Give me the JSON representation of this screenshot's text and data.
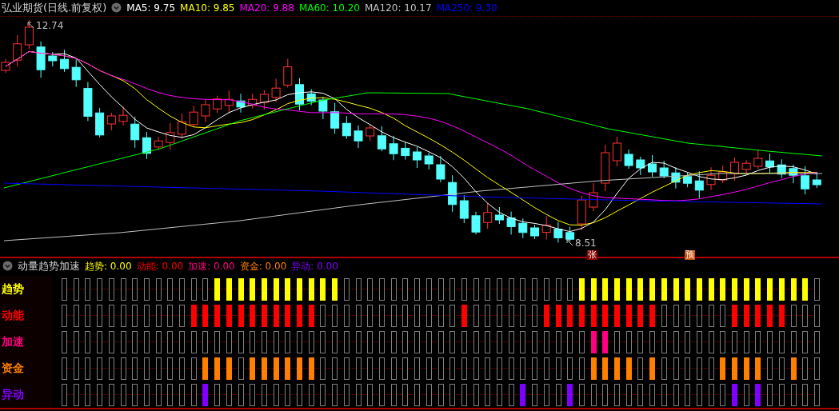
{
  "chart": {
    "title": "弘业期货(日线.前复权)",
    "ma_legend": [
      {
        "label": "MA5: 9.75",
        "color": "#ffffff"
      },
      {
        "label": "MA10: 9.85",
        "color": "#ffff00"
      },
      {
        "label": "MA20: 9.88",
        "color": "#ff00ff"
      },
      {
        "label": "MA60: 10.20",
        "color": "#00ff00"
      },
      {
        "label": "MA120: 10.17",
        "color": "#c0c0c0"
      },
      {
        "label": "MA250: 9.30",
        "color": "#0000ff"
      }
    ],
    "high_marker": "12.74",
    "low_marker": "8.51",
    "badges": [
      {
        "text": "张",
        "kind": "rise"
      },
      {
        "text": "预",
        "kind": "warn"
      }
    ]
  },
  "indicator": {
    "title": "动量趋势加速",
    "legend": [
      {
        "label": "趋势: 0.00",
        "color": "#ffff00"
      },
      {
        "label": "动能: 0.00",
        "color": "#ff0000"
      },
      {
        "label": "加速: 0.00",
        "color": "#ff0080"
      },
      {
        "label": "资金: 0.00",
        "color": "#ff8000"
      },
      {
        "label": "异动: 0.00",
        "color": "#8000ff"
      }
    ],
    "rows": [
      {
        "label": "趋势",
        "color": "#ffff00",
        "filled": [
          false,
          false,
          false,
          false,
          false,
          false,
          false,
          false,
          false,
          false,
          false,
          false,
          false,
          true,
          true,
          true,
          true,
          true,
          true,
          true,
          true,
          true,
          true,
          true,
          false,
          false,
          false,
          false,
          false,
          false,
          false,
          false,
          false,
          false,
          false,
          false,
          false,
          false,
          false,
          false,
          false,
          false,
          false,
          false,
          true,
          true,
          true,
          true,
          true,
          true,
          true,
          true,
          true,
          true,
          true,
          true,
          true,
          true,
          true,
          true,
          true,
          true,
          true,
          true,
          false
        ]
      },
      {
        "label": "动能",
        "color": "#ff0000",
        "filled": [
          false,
          false,
          false,
          false,
          false,
          false,
          false,
          false,
          false,
          false,
          false,
          true,
          true,
          true,
          true,
          true,
          true,
          true,
          true,
          true,
          true,
          true,
          false,
          false,
          false,
          false,
          false,
          false,
          false,
          false,
          false,
          false,
          false,
          false,
          true,
          false,
          false,
          false,
          false,
          false,
          false,
          true,
          true,
          true,
          true,
          true,
          true,
          true,
          true,
          true,
          true,
          false,
          false,
          false,
          false,
          false,
          false,
          true,
          true,
          true,
          true,
          true,
          false,
          false,
          false
        ]
      },
      {
        "label": "加速",
        "color": "#ff0080",
        "filled": [
          false,
          false,
          false,
          false,
          false,
          false,
          false,
          false,
          false,
          false,
          false,
          false,
          false,
          false,
          false,
          false,
          false,
          false,
          false,
          false,
          false,
          false,
          false,
          false,
          false,
          false,
          false,
          false,
          false,
          false,
          false,
          false,
          false,
          false,
          false,
          false,
          false,
          false,
          false,
          false,
          false,
          false,
          false,
          false,
          false,
          true,
          true,
          false,
          false,
          false,
          false,
          false,
          false,
          false,
          false,
          false,
          false,
          false,
          false,
          false,
          false,
          false,
          false,
          false,
          false
        ]
      },
      {
        "label": "资金",
        "color": "#ff8000",
        "filled": [
          false,
          false,
          false,
          false,
          false,
          false,
          false,
          false,
          false,
          false,
          false,
          false,
          true,
          true,
          true,
          false,
          true,
          true,
          true,
          true,
          true,
          true,
          false,
          false,
          false,
          false,
          false,
          false,
          false,
          false,
          false,
          false,
          false,
          false,
          false,
          false,
          false,
          false,
          false,
          false,
          false,
          false,
          false,
          false,
          false,
          true,
          true,
          true,
          true,
          false,
          true,
          false,
          false,
          false,
          false,
          false,
          true,
          true,
          true,
          true,
          false,
          false,
          true,
          false,
          false
        ]
      },
      {
        "label": "异动",
        "color": "#8000ff",
        "filled": [
          false,
          false,
          false,
          false,
          false,
          false,
          false,
          false,
          false,
          false,
          false,
          false,
          true,
          false,
          false,
          false,
          false,
          false,
          false,
          false,
          false,
          false,
          false,
          false,
          false,
          false,
          false,
          false,
          false,
          false,
          false,
          false,
          false,
          false,
          false,
          false,
          false,
          false,
          false,
          true,
          false,
          false,
          false,
          true,
          false,
          false,
          false,
          false,
          false,
          false,
          false,
          false,
          false,
          false,
          false,
          false,
          false,
          true,
          false,
          true,
          false,
          false,
          false,
          false,
          false
        ]
      }
    ]
  }
}
